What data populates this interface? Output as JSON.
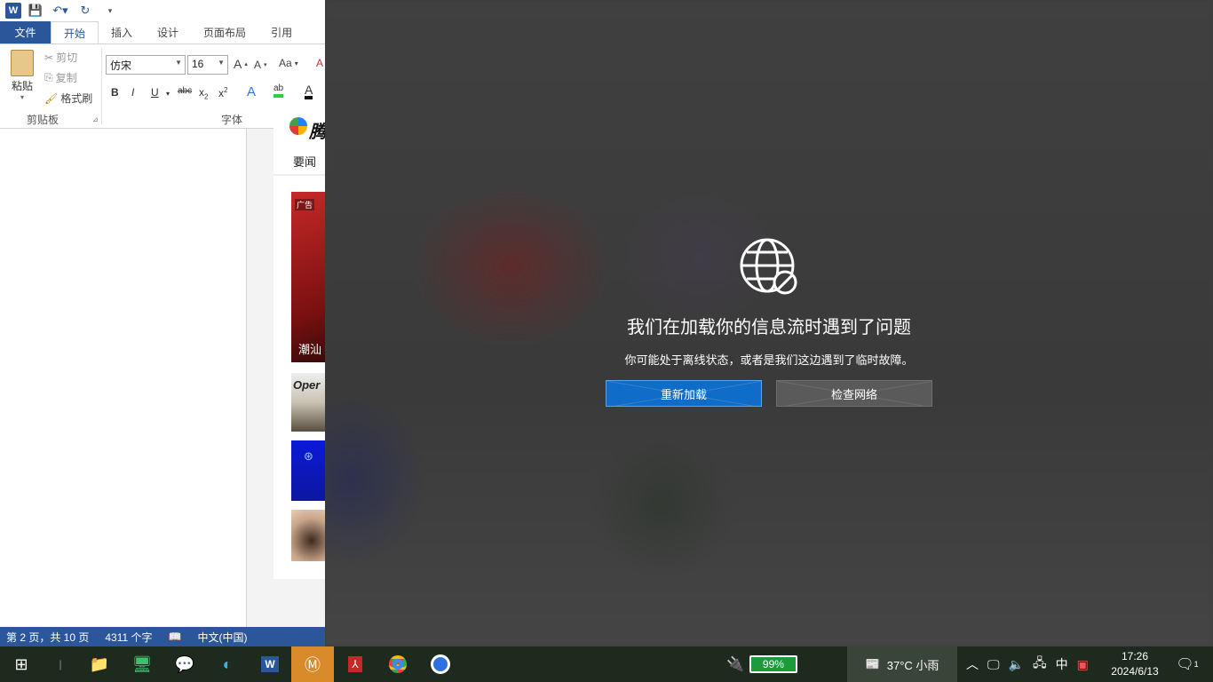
{
  "word": {
    "qat": {
      "logo": "W"
    },
    "tabs": [
      "文件",
      "开始",
      "插入",
      "设计",
      "页面布局",
      "引用"
    ],
    "clipboard": {
      "paste": "粘贴",
      "cut": "剪切",
      "copy": "复制",
      "format_painter": "格式刷",
      "group": "剪贴板"
    },
    "font": {
      "family": "仿宋",
      "size": "16",
      "group": "字体",
      "change_case": "Aa"
    },
    "status": {
      "page": "第 2 页，共 10 页",
      "words": "4311 个字",
      "lang": "中文(中国)"
    }
  },
  "news": {
    "logo_text": "腾",
    "nav_item": "要闻",
    "ad_label": "广告",
    "headline": "潮汕",
    "thumb2_text": "Oper"
  },
  "feed": {
    "title": "我们在加载你的信息流时遇到了问题",
    "subtitle": "你可能处于离线状态，或者是我们这边遇到了临时故障。",
    "reload": "重新加载",
    "check_network": "检查网络"
  },
  "taskbar": {
    "battery": "99%",
    "weather": "37°C 小雨",
    "ime": "中",
    "time": "17:26",
    "date": "2024/6/13",
    "notif_count": "1"
  },
  "colors": {
    "word_blue": "#2b579a",
    "primary_button": "#0f6cc9",
    "taskbar": "#1f2a1f"
  }
}
